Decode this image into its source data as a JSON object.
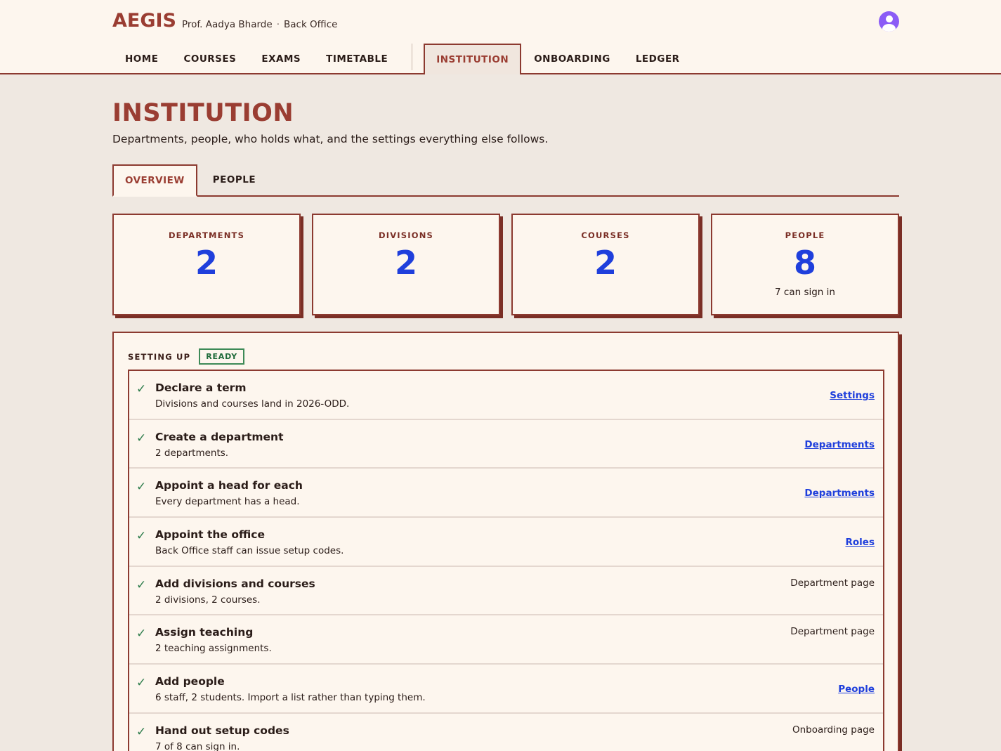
{
  "header": {
    "brand": "AEGIS",
    "user_name": "Prof. Aadya Bharde",
    "separator": "·",
    "role": "Back Office"
  },
  "nav": {
    "items": [
      {
        "label": "HOME"
      },
      {
        "label": "COURSES"
      },
      {
        "label": "EXAMS"
      },
      {
        "label": "TIMETABLE"
      },
      {
        "label": "INSTITUTION"
      },
      {
        "label": "ONBOARDING"
      },
      {
        "label": "LEDGER"
      }
    ],
    "active": "INSTITUTION"
  },
  "page": {
    "title": "INSTITUTION",
    "subtitle": "Departments, people, who holds what, and the settings everything else follows."
  },
  "tabs": {
    "items": [
      {
        "label": "OVERVIEW"
      },
      {
        "label": "PEOPLE"
      }
    ],
    "active": "OVERVIEW"
  },
  "stats": [
    {
      "label": "DEPARTMENTS",
      "value": "2",
      "note": ""
    },
    {
      "label": "DIVISIONS",
      "value": "2",
      "note": ""
    },
    {
      "label": "COURSES",
      "value": "2",
      "note": ""
    },
    {
      "label": "PEOPLE",
      "value": "8",
      "note": "7 can sign in"
    }
  ],
  "setup": {
    "title": "SETTING UP",
    "badge": "READY",
    "steps": [
      {
        "title": "Declare a term",
        "desc": "Divisions and courses land in 2026-ODD.",
        "link": "Settings",
        "note": ""
      },
      {
        "title": "Create a department",
        "desc": "2 departments.",
        "link": "Departments",
        "note": ""
      },
      {
        "title": "Appoint a head for each",
        "desc": "Every department has a head.",
        "link": "Departments",
        "note": ""
      },
      {
        "title": "Appoint the office",
        "desc": "Back Office staff can issue setup codes.",
        "link": "Roles",
        "note": ""
      },
      {
        "title": "Add divisions and courses",
        "desc": "2 divisions, 2 courses.",
        "link": "",
        "note": "Department page"
      },
      {
        "title": "Assign teaching",
        "desc": "2 teaching assignments.",
        "link": "",
        "note": "Department page"
      },
      {
        "title": "Add people",
        "desc": "6 staff, 2 students. Import a list rather than typing them.",
        "link": "People",
        "note": ""
      },
      {
        "title": "Hand out setup codes",
        "desc": "7 of 8 can sign in.",
        "link": "",
        "note": "Onboarding page"
      }
    ]
  },
  "colors": {
    "accent": "#9a3d32",
    "link": "#1f3fdc",
    "ok": "#2e7d4c"
  }
}
